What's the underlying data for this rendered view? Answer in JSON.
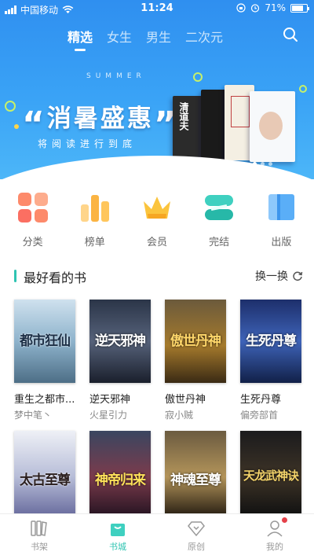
{
  "status_bar": {
    "carrier": "中国移动",
    "time": "11:24",
    "battery": "71%"
  },
  "top_tabs": [
    {
      "label": "精选",
      "active": true
    },
    {
      "label": "女生",
      "active": false
    },
    {
      "label": "男生",
      "active": false
    },
    {
      "label": "二次元",
      "active": false
    }
  ],
  "banner": {
    "small_text": "SUMMER",
    "title": "消暑盛惠",
    "subtitle": "将阅读进行到底",
    "book1_title": "清道夫",
    "active_dot": 0,
    "dot_count": 3
  },
  "categories": [
    {
      "label": "分类",
      "icon": "grid-icon"
    },
    {
      "label": "榜单",
      "icon": "bar-chart-icon"
    },
    {
      "label": "会员",
      "icon": "crown-icon"
    },
    {
      "label": "完结",
      "icon": "layers-icon"
    },
    {
      "label": "出版",
      "icon": "book-icon"
    }
  ],
  "section": {
    "title": "最好看的书",
    "action_label": "换一换"
  },
  "books_row1": [
    {
      "title": "重生之都市...",
      "author": "梦中笔丶",
      "cover_text": "都市狂仙"
    },
    {
      "title": "逆天邪神",
      "author": "火星引力",
      "cover_text": "逆天邪神"
    },
    {
      "title": "傲世丹神",
      "author": "寂小贼",
      "cover_text": "傲世丹神"
    },
    {
      "title": "生死丹尊",
      "author": "偏旁部首",
      "cover_text": "生死丹尊"
    }
  ],
  "books_row2": [
    {
      "cover_text": "太古至尊"
    },
    {
      "cover_text": "神帝归来"
    },
    {
      "cover_text": "神魂至尊"
    },
    {
      "cover_text": "天龙武神诀"
    }
  ],
  "bottom_nav": [
    {
      "label": "书架",
      "icon": "bookshelf-icon",
      "active": false
    },
    {
      "label": "书城",
      "icon": "shopping-bag-icon",
      "active": true
    },
    {
      "label": "原创",
      "icon": "diamond-icon",
      "active": false
    },
    {
      "label": "我的",
      "icon": "user-icon",
      "active": false,
      "badge": true
    }
  ],
  "colors": {
    "accent": "#2fc4b2",
    "banner_blue": "#3aa3f6",
    "badge_red": "#e5414a"
  }
}
